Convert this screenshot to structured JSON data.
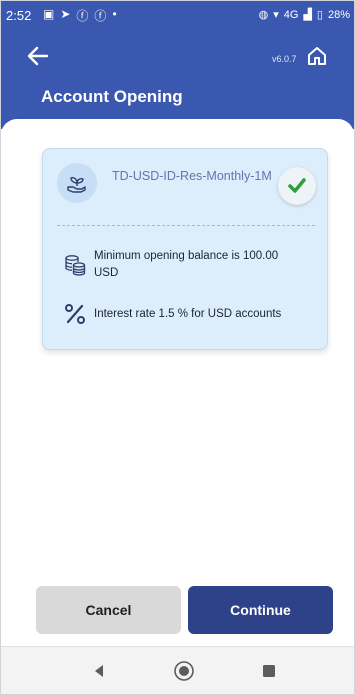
{
  "status_bar": {
    "time": "2:52",
    "network": "4G",
    "battery": "28%"
  },
  "header": {
    "title": "Account Opening",
    "version": "v6.0.7"
  },
  "card": {
    "plan_name": "TD-USD-ID-Res-Monthly-1M",
    "info": [
      {
        "icon": "coins-icon",
        "text": "Minimum opening balance is 100.00 USD"
      },
      {
        "icon": "percent-icon",
        "text": "Interest rate 1.5 % for USD accounts"
      }
    ]
  },
  "buttons": {
    "cancel": "Cancel",
    "continue": "Continue"
  },
  "colors": {
    "primary": "#3b58b0",
    "continue_button": "#2e4289",
    "card_bg": "#dcedfb",
    "check_green": "#2e9e3a"
  }
}
